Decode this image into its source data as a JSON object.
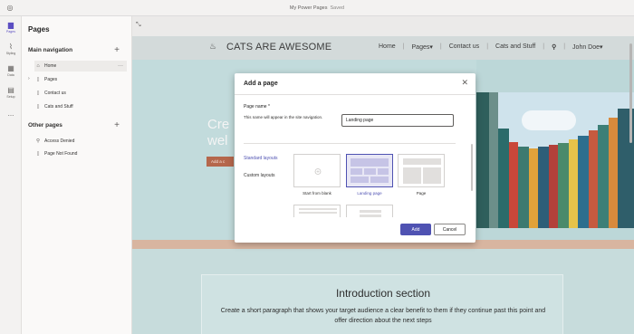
{
  "window": {
    "title": "My Power Pages",
    "status": "Saved"
  },
  "rail": {
    "items": [
      {
        "label": "Pages",
        "icon": "page-icon",
        "active": true
      },
      {
        "label": "Styling",
        "icon": "paintbrush-icon",
        "active": false
      },
      {
        "label": "Data",
        "icon": "table-icon",
        "active": false
      },
      {
        "label": "Setup",
        "icon": "setup-icon",
        "active": false
      },
      {
        "label": "...",
        "icon": "more-icon",
        "active": false
      }
    ]
  },
  "pages_panel": {
    "title": "Pages",
    "main_nav": {
      "label": "Main navigation",
      "items": [
        "Home",
        "Pages",
        "Contact us",
        "Cats and Stuff"
      ]
    },
    "other_pages": {
      "label": "Other pages",
      "items": [
        "Access Denied",
        "Page Not Found"
      ]
    }
  },
  "site": {
    "title": "CATS ARE AWESOME",
    "nav": [
      "Home",
      "Pages▾",
      "Contact us",
      "Cats and Stuff",
      "John Doe▾"
    ],
    "hero_heading_line1": "Cre",
    "hero_heading_line2": "wel",
    "hero_button": "Add a c",
    "intro_title": "Introduction section",
    "intro_text": "Create a short paragraph that shows your target audience a clear benefit to them if they continue past this point and offer direction about the next steps"
  },
  "modal": {
    "title": "Add a page",
    "close": "✕",
    "page_name_label": "Page name *",
    "page_name_help": "This name will appear in the site navigation.",
    "page_name_value": "Landing page",
    "tabs": [
      "Standard layouts",
      "Custom layouts"
    ],
    "layouts": [
      {
        "label": "Start from blank",
        "selected": false
      },
      {
        "label": "Landing page",
        "selected": true
      },
      {
        "label": "Page",
        "selected": false
      }
    ],
    "add_button": "Add",
    "cancel_button": "Cancel"
  },
  "colors": {
    "accent": "#4f52b2",
    "hero_button": "#b5674c"
  }
}
